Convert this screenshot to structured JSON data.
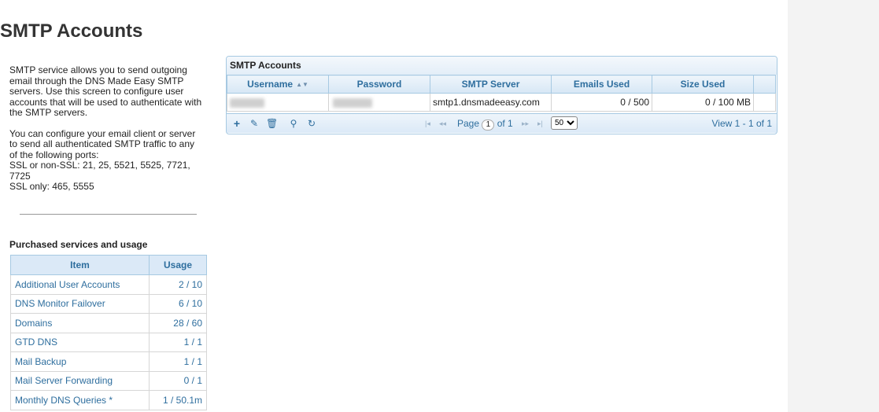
{
  "page": {
    "title": "SMTP Accounts"
  },
  "description": {
    "para1": [
      "SMTP service allows you to send outgoing",
      "email through the DNS Made Easy SMTP",
      "servers. Use this screen to configure user",
      "accounts that will be used to authenticate with",
      "the SMTP servers."
    ],
    "para2": [
      "You can configure your email client or server",
      "to send all authenticated SMTP traffic to any",
      "of the following ports:",
      "SSL or non-SSL: 21, 25, 5521, 5525, 7721,",
      "7725",
      "SSL only: 465, 5555"
    ]
  },
  "usage": {
    "heading": "Purchased services and usage",
    "columns": [
      "Item",
      "Usage"
    ],
    "rows": [
      {
        "item": "Additional User Accounts",
        "usage": "2 / 10"
      },
      {
        "item": "DNS Monitor Failover",
        "usage": "6 / 10"
      },
      {
        "item": "Domains",
        "usage": "28 / 60"
      },
      {
        "item": "GTD DNS",
        "usage": "1 / 1"
      },
      {
        "item": "Mail Backup",
        "usage": "1 / 1"
      },
      {
        "item": "Mail Server Forwarding",
        "usage": "0 / 1"
      },
      {
        "item": "Monthly DNS Queries *",
        "usage": "1 / 50.1m"
      }
    ]
  },
  "grid": {
    "caption": "SMTP Accounts",
    "columns": {
      "username": "Username",
      "password": "Password",
      "server": "SMTP Server",
      "emails": "Emails Used",
      "size": "Size Used"
    },
    "rows": [
      {
        "username": "",
        "password": "",
        "server": "smtp1.dnsmadeeasy.com",
        "emails": "0 / 500",
        "size": "0 / 100 MB"
      }
    ],
    "pager": {
      "page_label": "Page",
      "page_value": "1",
      "of_label": "of 1",
      "page_size": "50",
      "view_text": "View 1 - 1 of 1"
    },
    "toolbar_icons": [
      "add-icon",
      "edit-icon",
      "delete-icon",
      "search-icon",
      "refresh-icon"
    ]
  }
}
